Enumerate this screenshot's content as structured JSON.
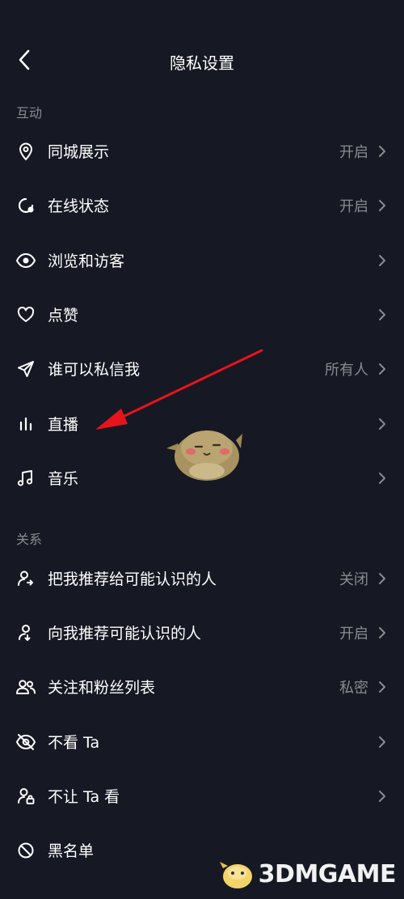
{
  "header": {
    "title": "隐私设置"
  },
  "sections": [
    {
      "label": "互动",
      "items": [
        {
          "icon": "location-pin-icon",
          "label": "同城展示",
          "value": "开启"
        },
        {
          "icon": "online-status-icon",
          "label": "在线状态",
          "value": "开启"
        },
        {
          "icon": "eye-icon",
          "label": "浏览和访客",
          "value": ""
        },
        {
          "icon": "heart-icon",
          "label": "点赞",
          "value": ""
        },
        {
          "icon": "paper-plane-icon",
          "label": "谁可以私信我",
          "value": "所有人"
        },
        {
          "icon": "live-bars-icon",
          "label": "直播",
          "value": ""
        },
        {
          "icon": "music-note-icon",
          "label": "音乐",
          "value": ""
        }
      ]
    },
    {
      "label": "关系",
      "items": [
        {
          "icon": "user-share-icon",
          "label": "把我推荐给可能认识的人",
          "value": "关闭"
        },
        {
          "icon": "user-recommend-icon",
          "label": "向我推荐可能认识的人",
          "value": "开启"
        },
        {
          "icon": "users-icon",
          "label": "关注和粉丝列表",
          "value": "私密"
        },
        {
          "icon": "eye-off-icon",
          "label": "不看 Ta",
          "value": ""
        },
        {
          "icon": "user-lock-icon",
          "label": "不让 Ta 看",
          "value": ""
        },
        {
          "icon": "block-icon",
          "label": "黑名单",
          "value": ""
        }
      ]
    }
  ],
  "watermark": {
    "text": "3DMGAME"
  },
  "colors": {
    "background": "#161823",
    "text": "#ffffff",
    "muted": "#8a8b91",
    "arrow": "#e8141c"
  }
}
